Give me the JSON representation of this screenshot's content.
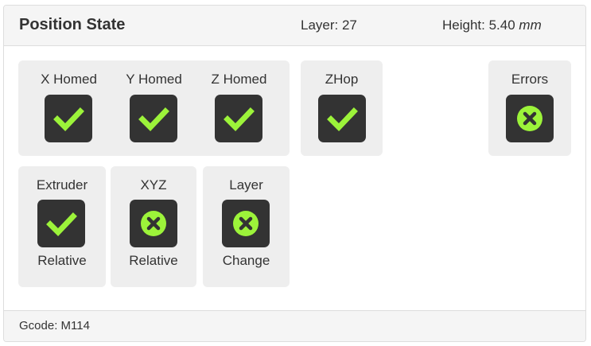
{
  "header": {
    "title": "Position State",
    "layer_label": "Layer: 27",
    "height_label": "Height: 5.40",
    "height_unit": "mm"
  },
  "homed": {
    "x_label": "X Homed",
    "y_label": "Y Homed",
    "z_label": "Z Homed"
  },
  "zhop": {
    "label": "ZHop"
  },
  "errors": {
    "label": "Errors"
  },
  "extruder_relative": {
    "label_top": "Extruder",
    "label_bottom": "Relative"
  },
  "xyz_relative": {
    "label_top": "XYZ",
    "label_bottom": "Relative"
  },
  "layer_change": {
    "label_top": "Layer",
    "label_bottom": "Change"
  },
  "icons": {
    "true_icon": "check-icon",
    "false_icon": "x-circle-icon",
    "accent_color": "#9cf33a",
    "icon_bg_color": "#333333"
  },
  "footer": {
    "gcode": "Gcode: M114"
  }
}
